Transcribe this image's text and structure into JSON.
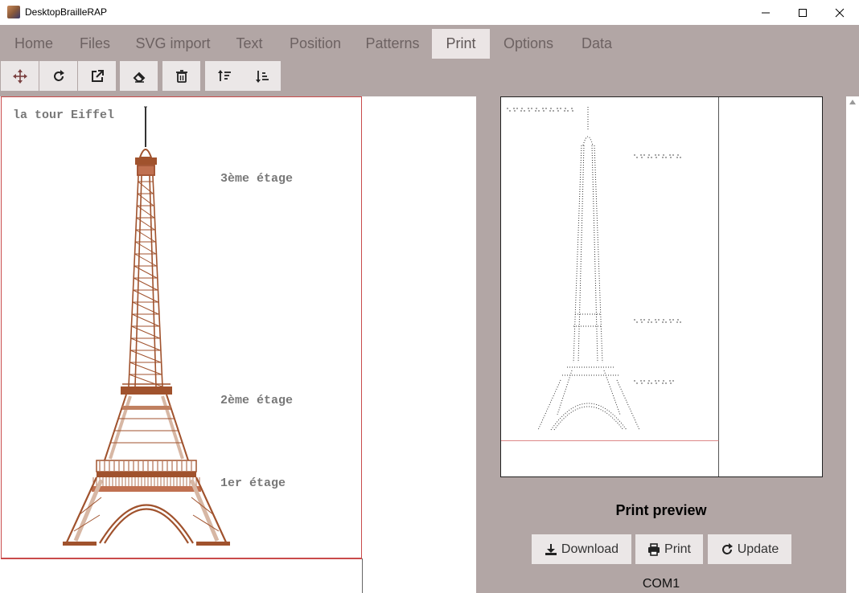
{
  "window": {
    "title": "DesktopBrailleRAP"
  },
  "menu": {
    "tabs": [
      {
        "label": "Home"
      },
      {
        "label": "Files"
      },
      {
        "label": "SVG import"
      },
      {
        "label": "Text"
      },
      {
        "label": "Position"
      },
      {
        "label": "Patterns"
      },
      {
        "label": "Print"
      },
      {
        "label": "Options"
      },
      {
        "label": "Data"
      }
    ],
    "active": "Print"
  },
  "toolbar": {
    "buttons": [
      {
        "icon": "move-icon"
      },
      {
        "icon": "rotate-icon"
      },
      {
        "icon": "external-link-icon"
      },
      {
        "icon": "eraser-icon"
      },
      {
        "icon": "trash-icon"
      },
      {
        "icon": "sort-up-icon"
      },
      {
        "icon": "sort-down-icon"
      }
    ]
  },
  "editor": {
    "title": "la tour Eiffel",
    "label_third": "3ème étage",
    "label_second": "2ème étage",
    "label_first": "1er étage"
  },
  "preview": {
    "title": "Print preview",
    "download_label": "Download",
    "print_label": "Print",
    "update_label": "Update",
    "port": "COM1"
  },
  "colors": {
    "chrome": "#b2a6a5",
    "tower": "#a0522d",
    "tower_light": "#d7b7a4",
    "paper_border": "#c94a4a"
  }
}
